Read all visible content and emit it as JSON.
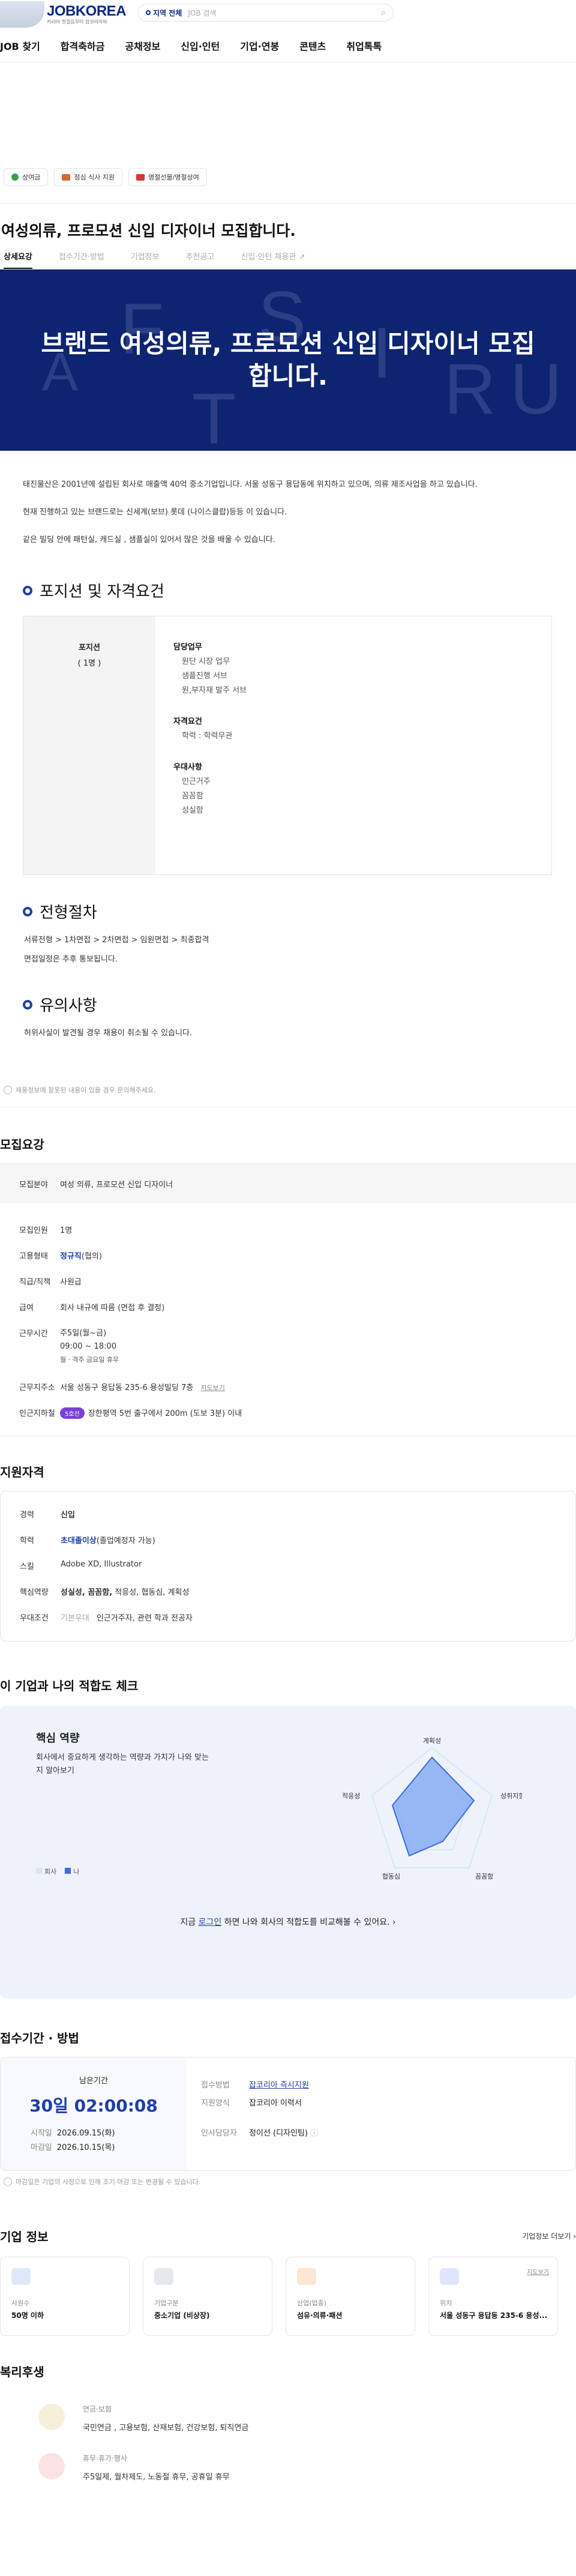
{
  "header": {
    "brand": "JOBKOREA",
    "tagline": "커리어 첫걸음부터 잡코리아와",
    "location": "지역 전체",
    "search_placeholder": "JOB 검색"
  },
  "nav": [
    "JOB 찾기",
    "합격축하금",
    "공채정보",
    "신입·인턴",
    "기업·연봉",
    "콘텐츠",
    "취업톡톡"
  ],
  "chips": [
    {
      "label": "상여금",
      "color": "#3a9e4c"
    },
    {
      "label": "점심 식사 지원",
      "color": "#d8682c"
    },
    {
      "label": "명절선물/명절상여",
      "color": "#d23a3a"
    }
  ],
  "title": "여성의류, 프로모션 신입 디자이너 모집합니다.",
  "tabs": [
    "상세요강",
    "접수기간·방법",
    "기업정보",
    "추천공고",
    "신입·인턴 채용관"
  ],
  "hero": {
    "heading": "브랜드 여성의류, 프로모션 신입 디자이너 모집합니다."
  },
  "intro": [
    "태진물산은 2001년에 설립된 회사로 매출액 40억 중소기업입니다. 서울 성동구 용답동에 위치하고 있으며, 의류 제조사업을 하고 있습니다.",
    "현재 진행하고 있는 브랜드로는 신세계(보브) 롯데 (나이스클랍)등등 이 있습니다.",
    "같은 빌딩 안에 패턴실, 캐드실 , 샘플실이 있어서 많은 것을 배울 수 있습니다."
  ],
  "position": {
    "section_title": "포지션 및 자격요건",
    "label": "포지션",
    "count": "( 1명 )",
    "duty_title": "담당업무",
    "duties": [
      "원단 시장 업무",
      "샘플진행 서브",
      "원,부자재 발주 서브"
    ],
    "qual_title": "자격요건",
    "quals": [
      "학력 : 학력무관"
    ],
    "pref_title": "우대사항",
    "prefs": [
      "인근거주",
      "꼼꼼함",
      "성실함"
    ]
  },
  "process": {
    "section_title": "전형절차",
    "steps": "서류전형 > 1차면접 > 2차면접 > 임원면접 > 최종합격",
    "note": "면접일정은 추후 통보됩니다."
  },
  "caution": {
    "section_title": "유의사항",
    "text": "허위사실이 발견될 경우 채용이 취소될 수 있습니다."
  },
  "detail_note": "채용정보에 잘못된 내용이 있을 경우 문의해주세요.",
  "summary": {
    "title": "모집요강",
    "rows": [
      {
        "k": "모집분야",
        "v": "여성 의류, 프로모션 신입 디자이너"
      },
      {
        "k": "모집인원",
        "v": "1명"
      },
      {
        "k": "고용형태",
        "v": "정규직",
        "v2": "(협의)"
      },
      {
        "k": "직급/직책",
        "v": "사원급"
      },
      {
        "k": "급여",
        "v": "회사 내규에 따름 (면접 후 결정)"
      },
      {
        "k": "근무시간",
        "list": [
          "주5일(월~금)",
          "09:00 ~ 18:00",
          "월ㆍ격주 금요일 휴무"
        ]
      },
      {
        "k": "근무지주소",
        "v": "서울 성동구 용답동 235-6 용성빌딩 7층",
        "link": "지도보기"
      },
      {
        "k": "인근지하철",
        "badge": "5호선",
        "v": "장한평역 5번 출구에서 200m (도보 3분) 이내"
      }
    ]
  },
  "qualify": {
    "title": "지원자격",
    "rows": [
      {
        "k": "경력",
        "v": "신입"
      },
      {
        "k": "학력",
        "v": "초대졸이상",
        "v2": "(졸업예정자 가능)"
      },
      {
        "k": "스킬",
        "v": "Adobe XD, Illustrator"
      },
      {
        "k": "핵심역량",
        "v": "성실성, 꼼꼼함,",
        "v2": " 적응성, 협동심, 계획성"
      },
      {
        "k": "우대조건",
        "tag": "기본우대",
        "v": "인근거주자, 관련 학과 전공자"
      }
    ]
  },
  "fit": {
    "title": "이 기업과 나의 적합도 체크",
    "card_title": "핵심 역량",
    "desc": "회사에서 중요하게 생각하는 역량과 가치가 나와 맞는지 알아보기",
    "axes": [
      "계획성",
      "성취지향성",
      "꼼꼼함",
      "협동심",
      "적응성"
    ],
    "legend_company": "회사",
    "legend_me": "나",
    "cta_pre": "지금 ",
    "cta_link": "로그인",
    "cta_post": " 하면 나와 회사의 적합도를 비교해볼 수 있어요."
  },
  "apply": {
    "title": "접수기간 · 방법",
    "remain_label": "남은기간",
    "remain": "30일 02:00:08",
    "start_label": "시작일",
    "start": "2026.09.15(화)",
    "end_label": "마감일",
    "end": "2026.10.15(목)",
    "method_label": "접수방법",
    "method": "잡코리아 즉시지원",
    "form_label": "지원양식",
    "form": "잡코리아 이력서",
    "contact_label": "인사담당자",
    "contact": "정이선 (디자인팀)",
    "note": "마감일은 기업의 사정으로 인해 조기 마감 또는 변경될 수 있습니다."
  },
  "company": {
    "title": "기업 정보",
    "more": "기업정보 더보기",
    "cards": [
      {
        "label": "사원수",
        "value": "50명 이하",
        "color": "#dfe8fb"
      },
      {
        "label": "기업구분",
        "value": "중소기업 (비상장)",
        "color": "#e6e8ee"
      },
      {
        "label": "산업(업종)",
        "value": "섬유·의류·패션",
        "color": "#fbe6d6"
      },
      {
        "label": "위치",
        "value": "서울 성동구 용답동 235-6 용성...",
        "link": "지도보기",
        "color": "#dfe6fb"
      }
    ]
  },
  "welfare": {
    "title": "복리후생",
    "items": [
      {
        "t": "연금·보험",
        "d": "국민연금 , 고용보험, 산재보험, 건강보험, 퇴직연금"
      },
      {
        "t": "휴무·휴가·행사",
        "d": "주5일제, 월차제도, 노동절 휴무, 공휴일 휴무"
      }
    ]
  }
}
